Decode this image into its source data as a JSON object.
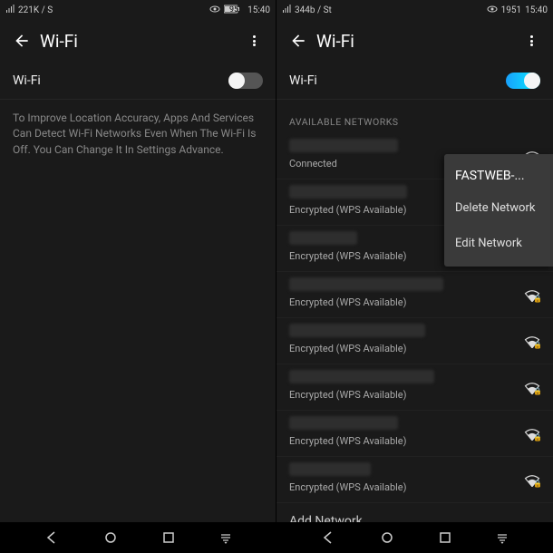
{
  "left": {
    "status": {
      "left_text": "221K / S",
      "battery": "95",
      "time": "15:40"
    },
    "header": {
      "title": "Wi-Fi"
    },
    "wifi": {
      "label": "Wi-Fi",
      "enabled": false
    },
    "hint": "To Improve Location Accuracy, Apps And Services Can Detect Wi-Fi Networks Even When The Wi-Fi Is Off. You Can Change It In Settings Advance."
  },
  "right": {
    "status": {
      "left_text": "344b / St",
      "battery": "1951",
      "time": "15:40"
    },
    "header": {
      "title": "Wi-Fi"
    },
    "wifi": {
      "label": "Wi-Fi",
      "enabled": true
    },
    "section_label": "AVAILABLE NETWORKS",
    "networks": [
      {
        "status": "Connected",
        "ssid_width": 120,
        "locked": false
      },
      {
        "status": "Encrypted (WPS Available)",
        "ssid_width": 130,
        "locked": true
      },
      {
        "status": "Encrypted (WPS Available)",
        "ssid_width": 75,
        "locked": true
      },
      {
        "status": "Encrypted (WPS Available)",
        "ssid_width": 170,
        "locked": true
      },
      {
        "status": "Encrypted (WPS Available)",
        "ssid_width": 150,
        "locked": true
      },
      {
        "status": "Encrypted (WPS Available)",
        "ssid_width": 160,
        "locked": true
      },
      {
        "status": "Encrypted (WPS Available)",
        "ssid_width": 120,
        "locked": true
      },
      {
        "status": "Encrypted (WPS Available)",
        "ssid_width": 90,
        "locked": true
      }
    ],
    "add_network": "Add Network",
    "context_menu": {
      "title": "FASTWEB-...",
      "items": [
        "Delete Network",
        "Edit Network"
      ]
    }
  }
}
